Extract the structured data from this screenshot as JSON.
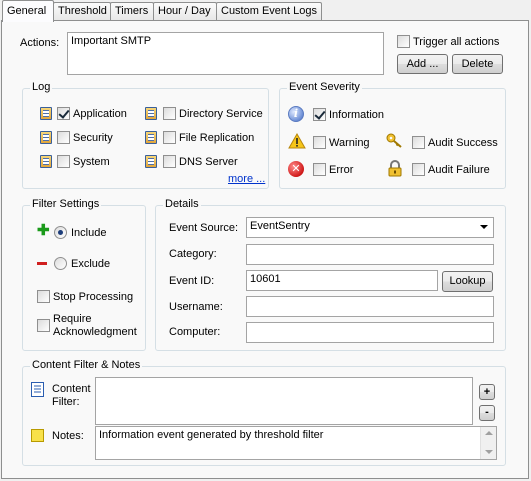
{
  "tabs": [
    "General",
    "Threshold",
    "Timers",
    "Hour / Day",
    "Custom Event Logs"
  ],
  "actions": {
    "label": "Actions:",
    "value": "Important SMTP",
    "trigger_all": "Trigger all actions",
    "add_label": "Add ...",
    "delete_label": "Delete"
  },
  "log": {
    "title": "Log",
    "items": [
      {
        "label": "Application",
        "checked": true
      },
      {
        "label": "Security",
        "checked": false
      },
      {
        "label": "System",
        "checked": false
      },
      {
        "label": "Directory Service",
        "checked": false
      },
      {
        "label": "File Replication",
        "checked": false
      },
      {
        "label": "DNS Server",
        "checked": false
      }
    ],
    "more": "more ..."
  },
  "severity": {
    "title": "Event Severity",
    "information": "Information",
    "warning": "Warning",
    "error": "Error",
    "audit_success": "Audit Success",
    "audit_failure": "Audit Failure"
  },
  "filter": {
    "title": "Filter Settings",
    "include": "Include",
    "exclude": "Exclude",
    "stop_processing": "Stop Processing",
    "require_ack": "Require Acknowledgment"
  },
  "details": {
    "title": "Details",
    "event_source_label": "Event Source:",
    "event_source_value": "EventSentry",
    "category_label": "Category:",
    "category_value": "",
    "event_id_label": "Event ID:",
    "event_id_value": "10601",
    "lookup_label": "Lookup",
    "username_label": "Username:",
    "username_value": "",
    "computer_label": "Computer:",
    "computer_value": ""
  },
  "content": {
    "title": "Content Filter & Notes",
    "filter_label": "Content Filter:",
    "filter_value": "",
    "notes_label": "Notes:",
    "notes_value": "Information event generated by threshold filter",
    "plus": "+",
    "minus": "-"
  }
}
